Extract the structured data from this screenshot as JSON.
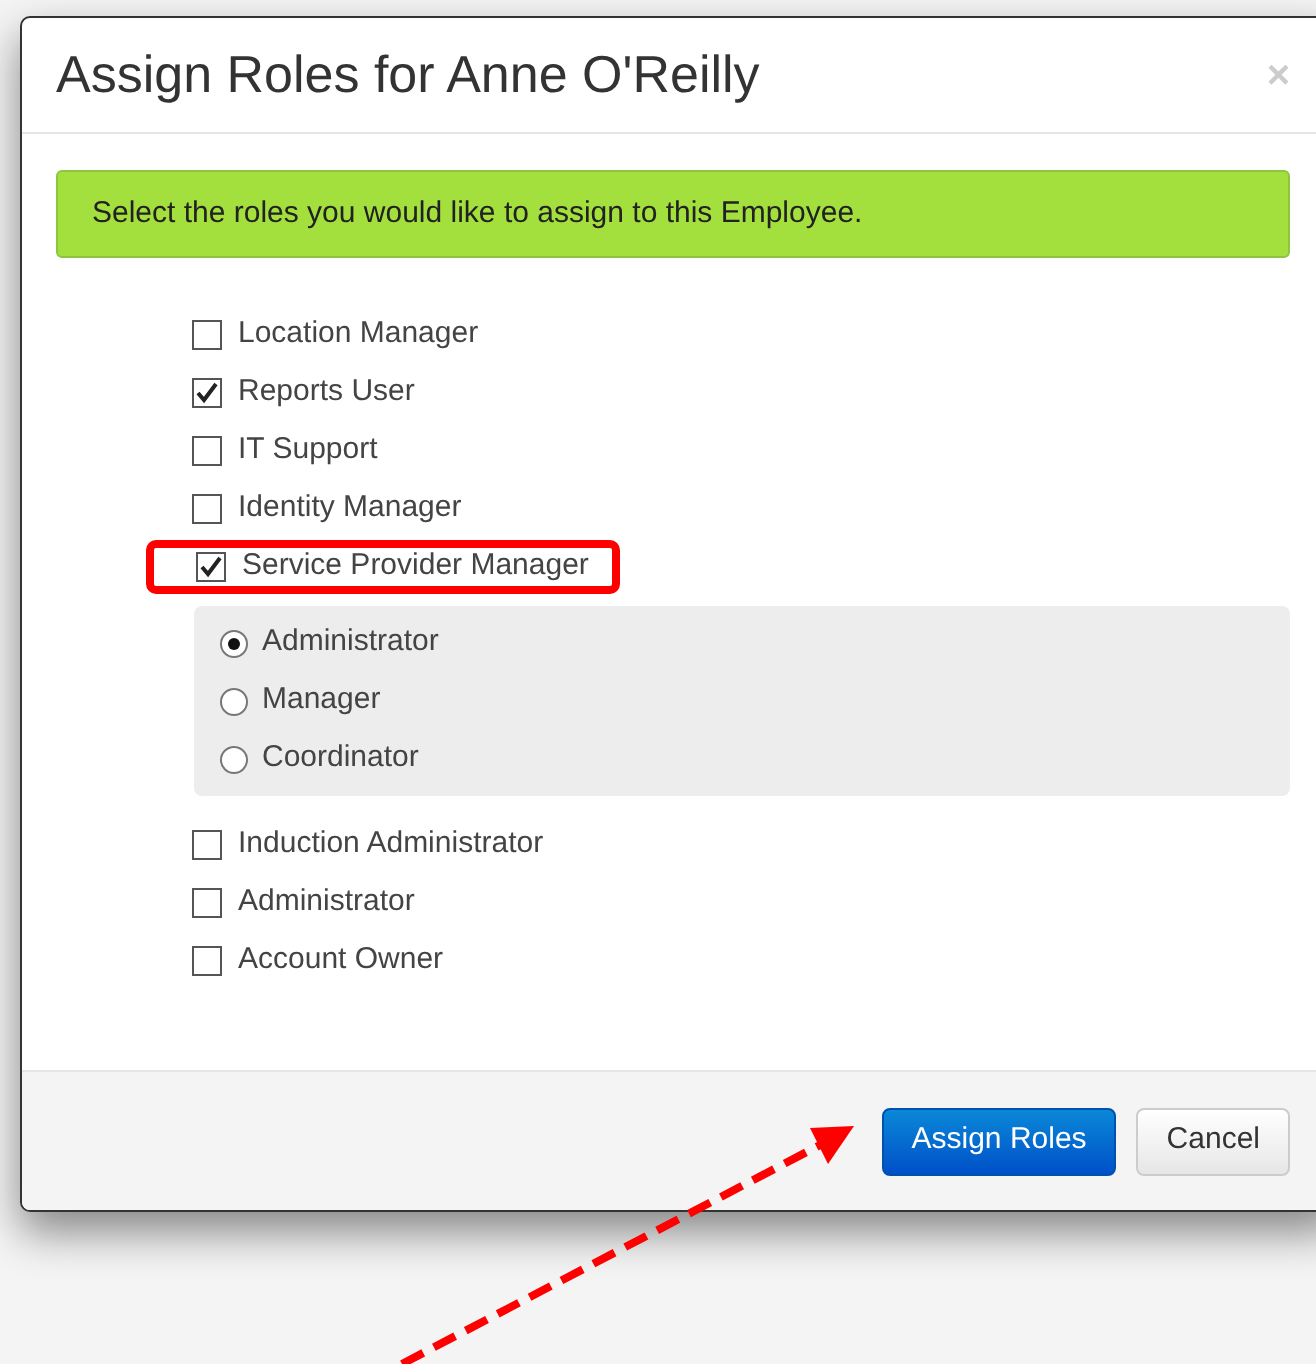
{
  "dialog": {
    "title": "Assign Roles for Anne O'Reilly",
    "close": "×"
  },
  "alert": "Select the roles you would like to assign to this Employee.",
  "roles": [
    {
      "label": "Location Manager",
      "checked": false,
      "highlighted": false
    },
    {
      "label": "Reports User",
      "checked": true,
      "highlighted": false
    },
    {
      "label": "IT Support",
      "checked": false,
      "highlighted": false
    },
    {
      "label": "Identity Manager",
      "checked": false,
      "highlighted": false
    },
    {
      "label": "Service Provider Manager",
      "checked": true,
      "highlighted": true,
      "options": [
        {
          "label": "Administrator",
          "selected": true
        },
        {
          "label": "Manager",
          "selected": false
        },
        {
          "label": "Coordinator",
          "selected": false
        }
      ]
    },
    {
      "label": "Induction Administrator",
      "checked": false,
      "highlighted": false
    },
    {
      "label": "Administrator",
      "checked": false,
      "highlighted": false
    },
    {
      "label": "Account Owner",
      "checked": false,
      "highlighted": false
    }
  ],
  "buttons": [
    {
      "label": "Assign Roles",
      "kind": "primary"
    },
    {
      "label": "Cancel",
      "kind": "default"
    }
  ],
  "annotation_arrow": true
}
